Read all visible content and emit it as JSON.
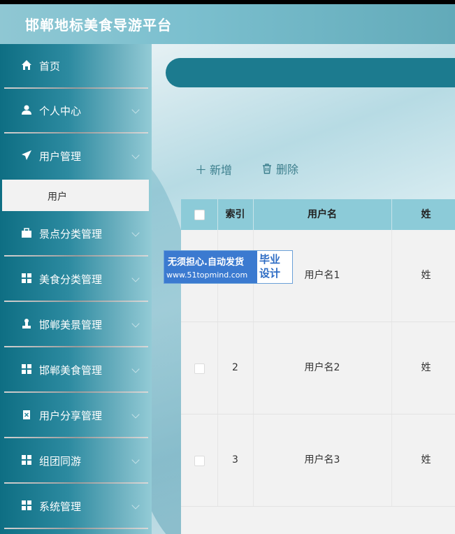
{
  "app": {
    "title": "邯郸地标美食导游平台"
  },
  "sidebar": {
    "items": [
      {
        "label": "首页",
        "icon": "home-icon",
        "has_arrow": false
      },
      {
        "label": "个人中心",
        "icon": "user-icon",
        "has_arrow": true
      },
      {
        "label": "用户管理",
        "icon": "send-icon",
        "has_arrow": true
      },
      {
        "label": "景点分类管理",
        "icon": "briefcase-icon",
        "has_arrow": true
      },
      {
        "label": "美食分类管理",
        "icon": "grid-icon",
        "has_arrow": true
      },
      {
        "label": "邯郸美景管理",
        "icon": "stamp-icon",
        "has_arrow": true
      },
      {
        "label": "邯郸美食管理",
        "icon": "grid-icon",
        "has_arrow": true
      },
      {
        "label": "用户分享管理",
        "icon": "clipboard-icon",
        "has_arrow": true
      },
      {
        "label": "组团同游",
        "icon": "grid-icon",
        "has_arrow": true
      },
      {
        "label": "系统管理",
        "icon": "grid-icon",
        "has_arrow": true
      }
    ],
    "submenu": {
      "label": "用户",
      "active": true
    }
  },
  "toolbar": {
    "add_label": "新增",
    "delete_label": "删除"
  },
  "table": {
    "headers": [
      "索引",
      "用户名",
      "姓"
    ],
    "rows": [
      {
        "index": "",
        "username": "用户名1",
        "name": "姓"
      },
      {
        "index": "2",
        "username": "用户名2",
        "name": "姓"
      },
      {
        "index": "3",
        "username": "用户名3",
        "name": "姓"
      }
    ]
  },
  "watermark": {
    "line1": "无须担心.自动发货",
    "line2": "www.51topmind.com",
    "badge1": "毕业",
    "badge2": "设计"
  },
  "colors": {
    "header": "#7cc0cf",
    "sidebar": "#2c8aa0",
    "search_bar": "#1c7b8f",
    "table_header": "#8ccbd8",
    "accent_text": "#3d7f8d"
  }
}
